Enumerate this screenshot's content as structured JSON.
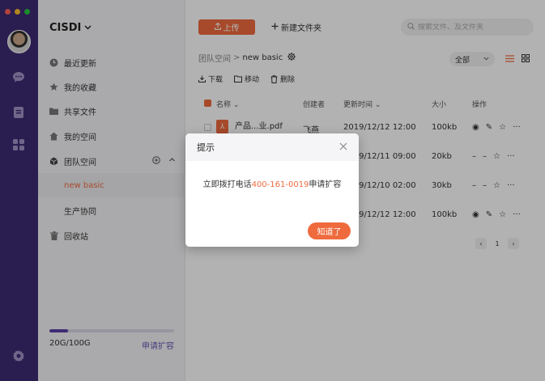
{
  "colors": {
    "rail": "#3d2a73",
    "accent": "#ef6b3e",
    "purple": "#5a3ea6"
  },
  "window": {
    "traffic_lights": [
      "#ff5f57",
      "#febc2e",
      "#28c840"
    ]
  },
  "rail": {
    "icons": [
      "chat-icon",
      "doc-icon",
      "apps-icon",
      "settings-icon"
    ]
  },
  "sidebar": {
    "org_name": "CISDI",
    "items": [
      {
        "label": "最近更新",
        "icon": "clock-icon"
      },
      {
        "label": "我的收藏",
        "icon": "star-icon"
      },
      {
        "label": "共享文件",
        "icon": "folder-icon"
      },
      {
        "label": "我的空间",
        "icon": "home-icon"
      },
      {
        "label": "团队空间",
        "icon": "cube-icon"
      }
    ],
    "team_sub": [
      {
        "label": "new basic",
        "active": true
      },
      {
        "label": "生产协同",
        "active": false
      }
    ],
    "recycle": {
      "label": "回收站",
      "icon": "trash-icon"
    },
    "storage": {
      "used": "20G/100G",
      "fraction": 0.15,
      "expand_label": "申请扩容"
    }
  },
  "main": {
    "upload_label": "上传",
    "new_folder_label": "新建文件夹",
    "search_placeholder": "搜索文件、及文件夹",
    "breadcrumb": {
      "root": "团队空间",
      "sep": ">",
      "current": "new basic"
    },
    "filter_value": "全部",
    "toolbar": {
      "download": "下载",
      "move": "移动",
      "delete": "删除"
    },
    "columns": {
      "name": "名称",
      "creator": "创建者",
      "updated": "更新时间",
      "size": "大小",
      "actions": "操作"
    },
    "rows": [
      {
        "name": "产品...业.pdf",
        "creator": "飞燕",
        "updated": "2019/12/12 12:00",
        "size": "100kb"
      },
      {
        "name": "",
        "creator": "",
        "updated": "2019/12/11 09:00",
        "size": "20kb"
      },
      {
        "name": "",
        "creator": "",
        "updated": "2019/12/10 02:00",
        "size": "30kb"
      },
      {
        "name": "",
        "creator": "",
        "updated": "2019/12/12 12:00",
        "size": "100kb"
      }
    ],
    "pagination": {
      "page": "1"
    }
  },
  "modal": {
    "title": "提示",
    "message_prefix": "立即拨打电话",
    "phone": "400-161-0019",
    "message_suffix": "申请扩容",
    "button_label": "知道了"
  }
}
